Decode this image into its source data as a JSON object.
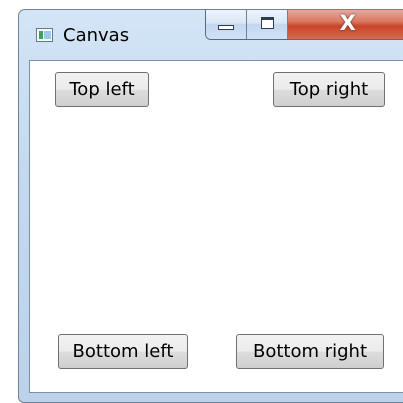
{
  "window": {
    "title": "Canvas",
    "icon": "app-window-icon",
    "caption_buttons": {
      "minimize_icon": "minimize-icon",
      "maximize_icon": "maximize-icon",
      "close_glyph": "X"
    }
  },
  "canvas": {
    "buttons": {
      "top_left": "Top left",
      "top_right": "Top right",
      "bottom_left": "Bottom left",
      "bottom_right": "Bottom right"
    }
  },
  "colors": {
    "frame": "#c4d9ef",
    "close_button": "#c8452a",
    "client_background": "#ffffff"
  }
}
